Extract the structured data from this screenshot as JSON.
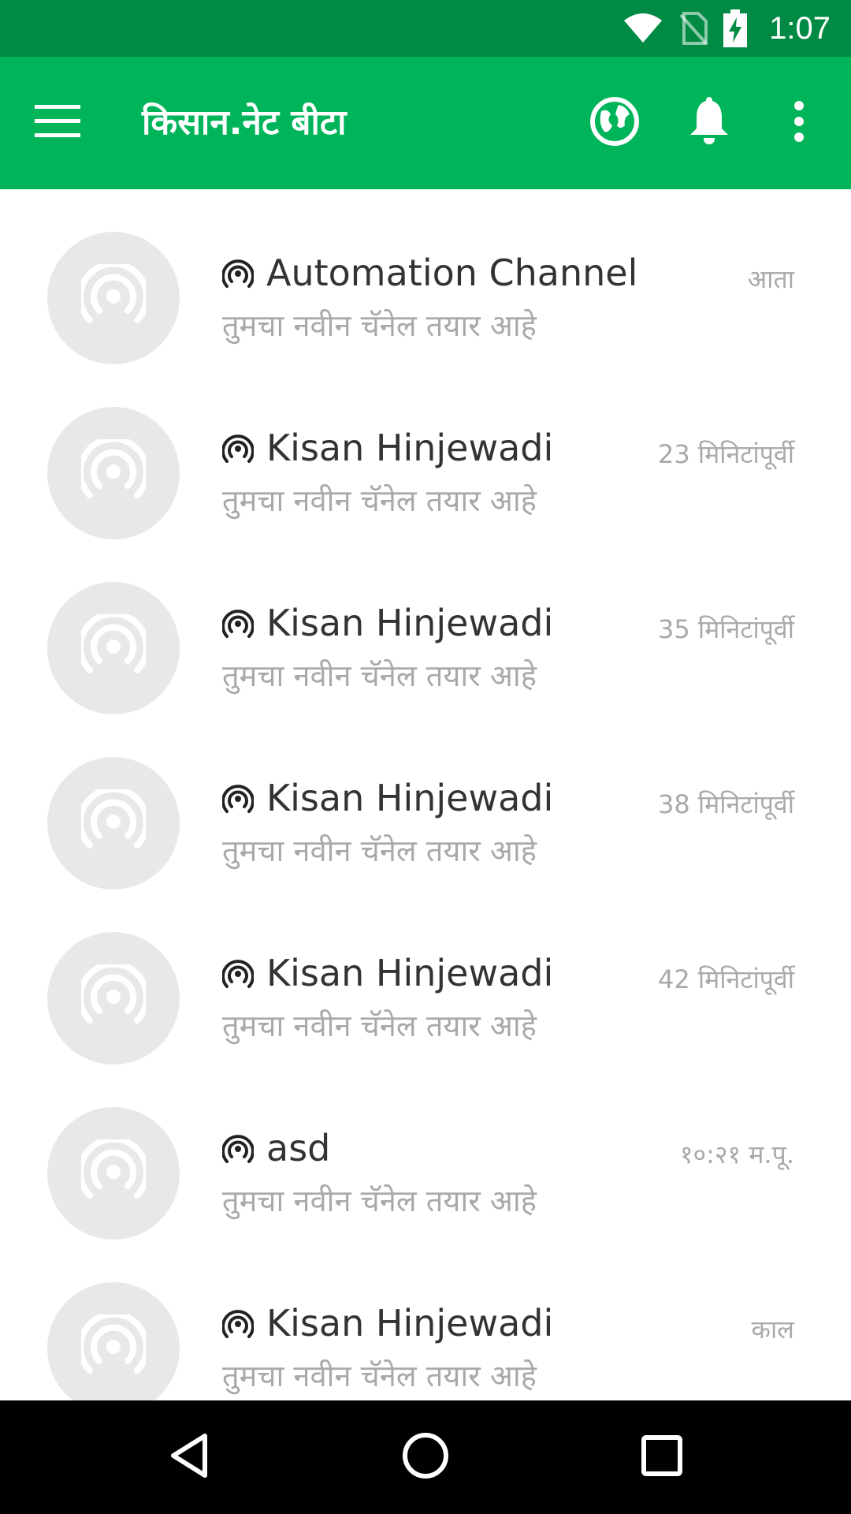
{
  "status_bar": {
    "time": "1:07",
    "icons": [
      "wifi-icon",
      "no-sim-icon",
      "battery-charging-icon"
    ]
  },
  "app_bar": {
    "title": "किसान.नेट बीटा",
    "icons": [
      "menu-icon",
      "globe-icon",
      "bell-icon",
      "more-vert-icon"
    ]
  },
  "colors": {
    "status_bar": "#008a43",
    "app_bar": "#00b45a",
    "avatar_bg": "#e8e8e8",
    "secondary_text": "#a9a9a9"
  },
  "channels": [
    {
      "name": "Automation Channel",
      "message": "तुमचा नवीन चॅनेल तयार आहे",
      "time": "आता"
    },
    {
      "name": "Kisan Hinjewadi",
      "message": "तुमचा नवीन चॅनेल तयार आहे",
      "time": "23 मिनिटांपूर्वी"
    },
    {
      "name": "Kisan Hinjewadi",
      "message": "तुमचा नवीन चॅनेल तयार आहे",
      "time": "35 मिनिटांपूर्वी"
    },
    {
      "name": "Kisan Hinjewadi",
      "message": "तुमचा नवीन चॅनेल तयार आहे",
      "time": "38 मिनिटांपूर्वी"
    },
    {
      "name": "Kisan Hinjewadi",
      "message": "तुमचा नवीन चॅनेल तयार आहे",
      "time": "42 मिनिटांपूर्वी"
    },
    {
      "name": "asd",
      "message": "तुमचा नवीन चॅनेल तयार आहे",
      "time": "१०:२१ म.पू."
    },
    {
      "name": "Kisan Hinjewadi",
      "message": "तुमचा नवीन चॅनेल तयार आहे",
      "time": "काल"
    }
  ],
  "nav_bar": {
    "icons": [
      "back-icon",
      "home-icon",
      "recents-icon"
    ]
  }
}
